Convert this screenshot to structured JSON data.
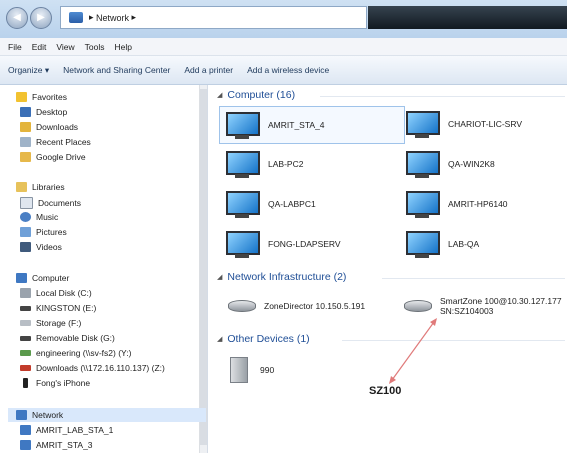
{
  "address": {
    "segments": [
      "Network"
    ]
  },
  "menu": [
    "File",
    "Edit",
    "View",
    "Tools",
    "Help"
  ],
  "toolbar": {
    "organize": "Organize ▾",
    "network_sharing": "Network and Sharing Center",
    "add_printer": "Add a printer",
    "add_wireless": "Add a wireless device"
  },
  "nav": {
    "favorites": "Favorites",
    "favorites_items": [
      "Desktop",
      "Downloads",
      "Recent Places",
      "Google Drive"
    ],
    "libraries": "Libraries",
    "libraries_items": [
      "Documents",
      "Music",
      "Pictures",
      "Videos"
    ],
    "computer": "Computer",
    "computer_items": [
      "Local Disk (C:)",
      "KINGSTON (E:)",
      "Storage (F:)",
      "Removable Disk (G:)",
      "engineering (\\\\sv-fs2) (Y:)",
      "Downloads (\\\\172.16.110.137) (Z:)",
      "Fong's iPhone"
    ],
    "network": "Network",
    "network_items": [
      "AMRIT_LAB_STA_1",
      "AMRIT_STA_3"
    ]
  },
  "groups": {
    "computer": "Computer (16)",
    "infrastructure": "Network Infrastructure (2)",
    "other": "Other Devices (1)"
  },
  "computers": [
    "AMRIT_STA_4",
    "CHARIOT-LIC-SRV",
    "LAB-PC2",
    "QA-WIN2K8",
    "QA-LABPC1",
    "AMRIT-HP6140",
    "FONG-LDAPSERV",
    "LAB-QA"
  ],
  "infrastructure": [
    {
      "name": "ZoneDirector 10.150.5.191"
    },
    {
      "name": "SmartZone 100@10.30.127.177",
      "sn": "SN:SZ104003"
    }
  ],
  "other_devices": [
    "990"
  ],
  "annotation": "SZ100",
  "colors": {
    "group_header": "#1f4e96",
    "annotation_arrow": "#e07a7a",
    "selection": "#d9e8fb"
  },
  "icons": {
    "back": "back-arrow-icon",
    "forward": "forward-arrow-icon",
    "network": "network-icon"
  }
}
